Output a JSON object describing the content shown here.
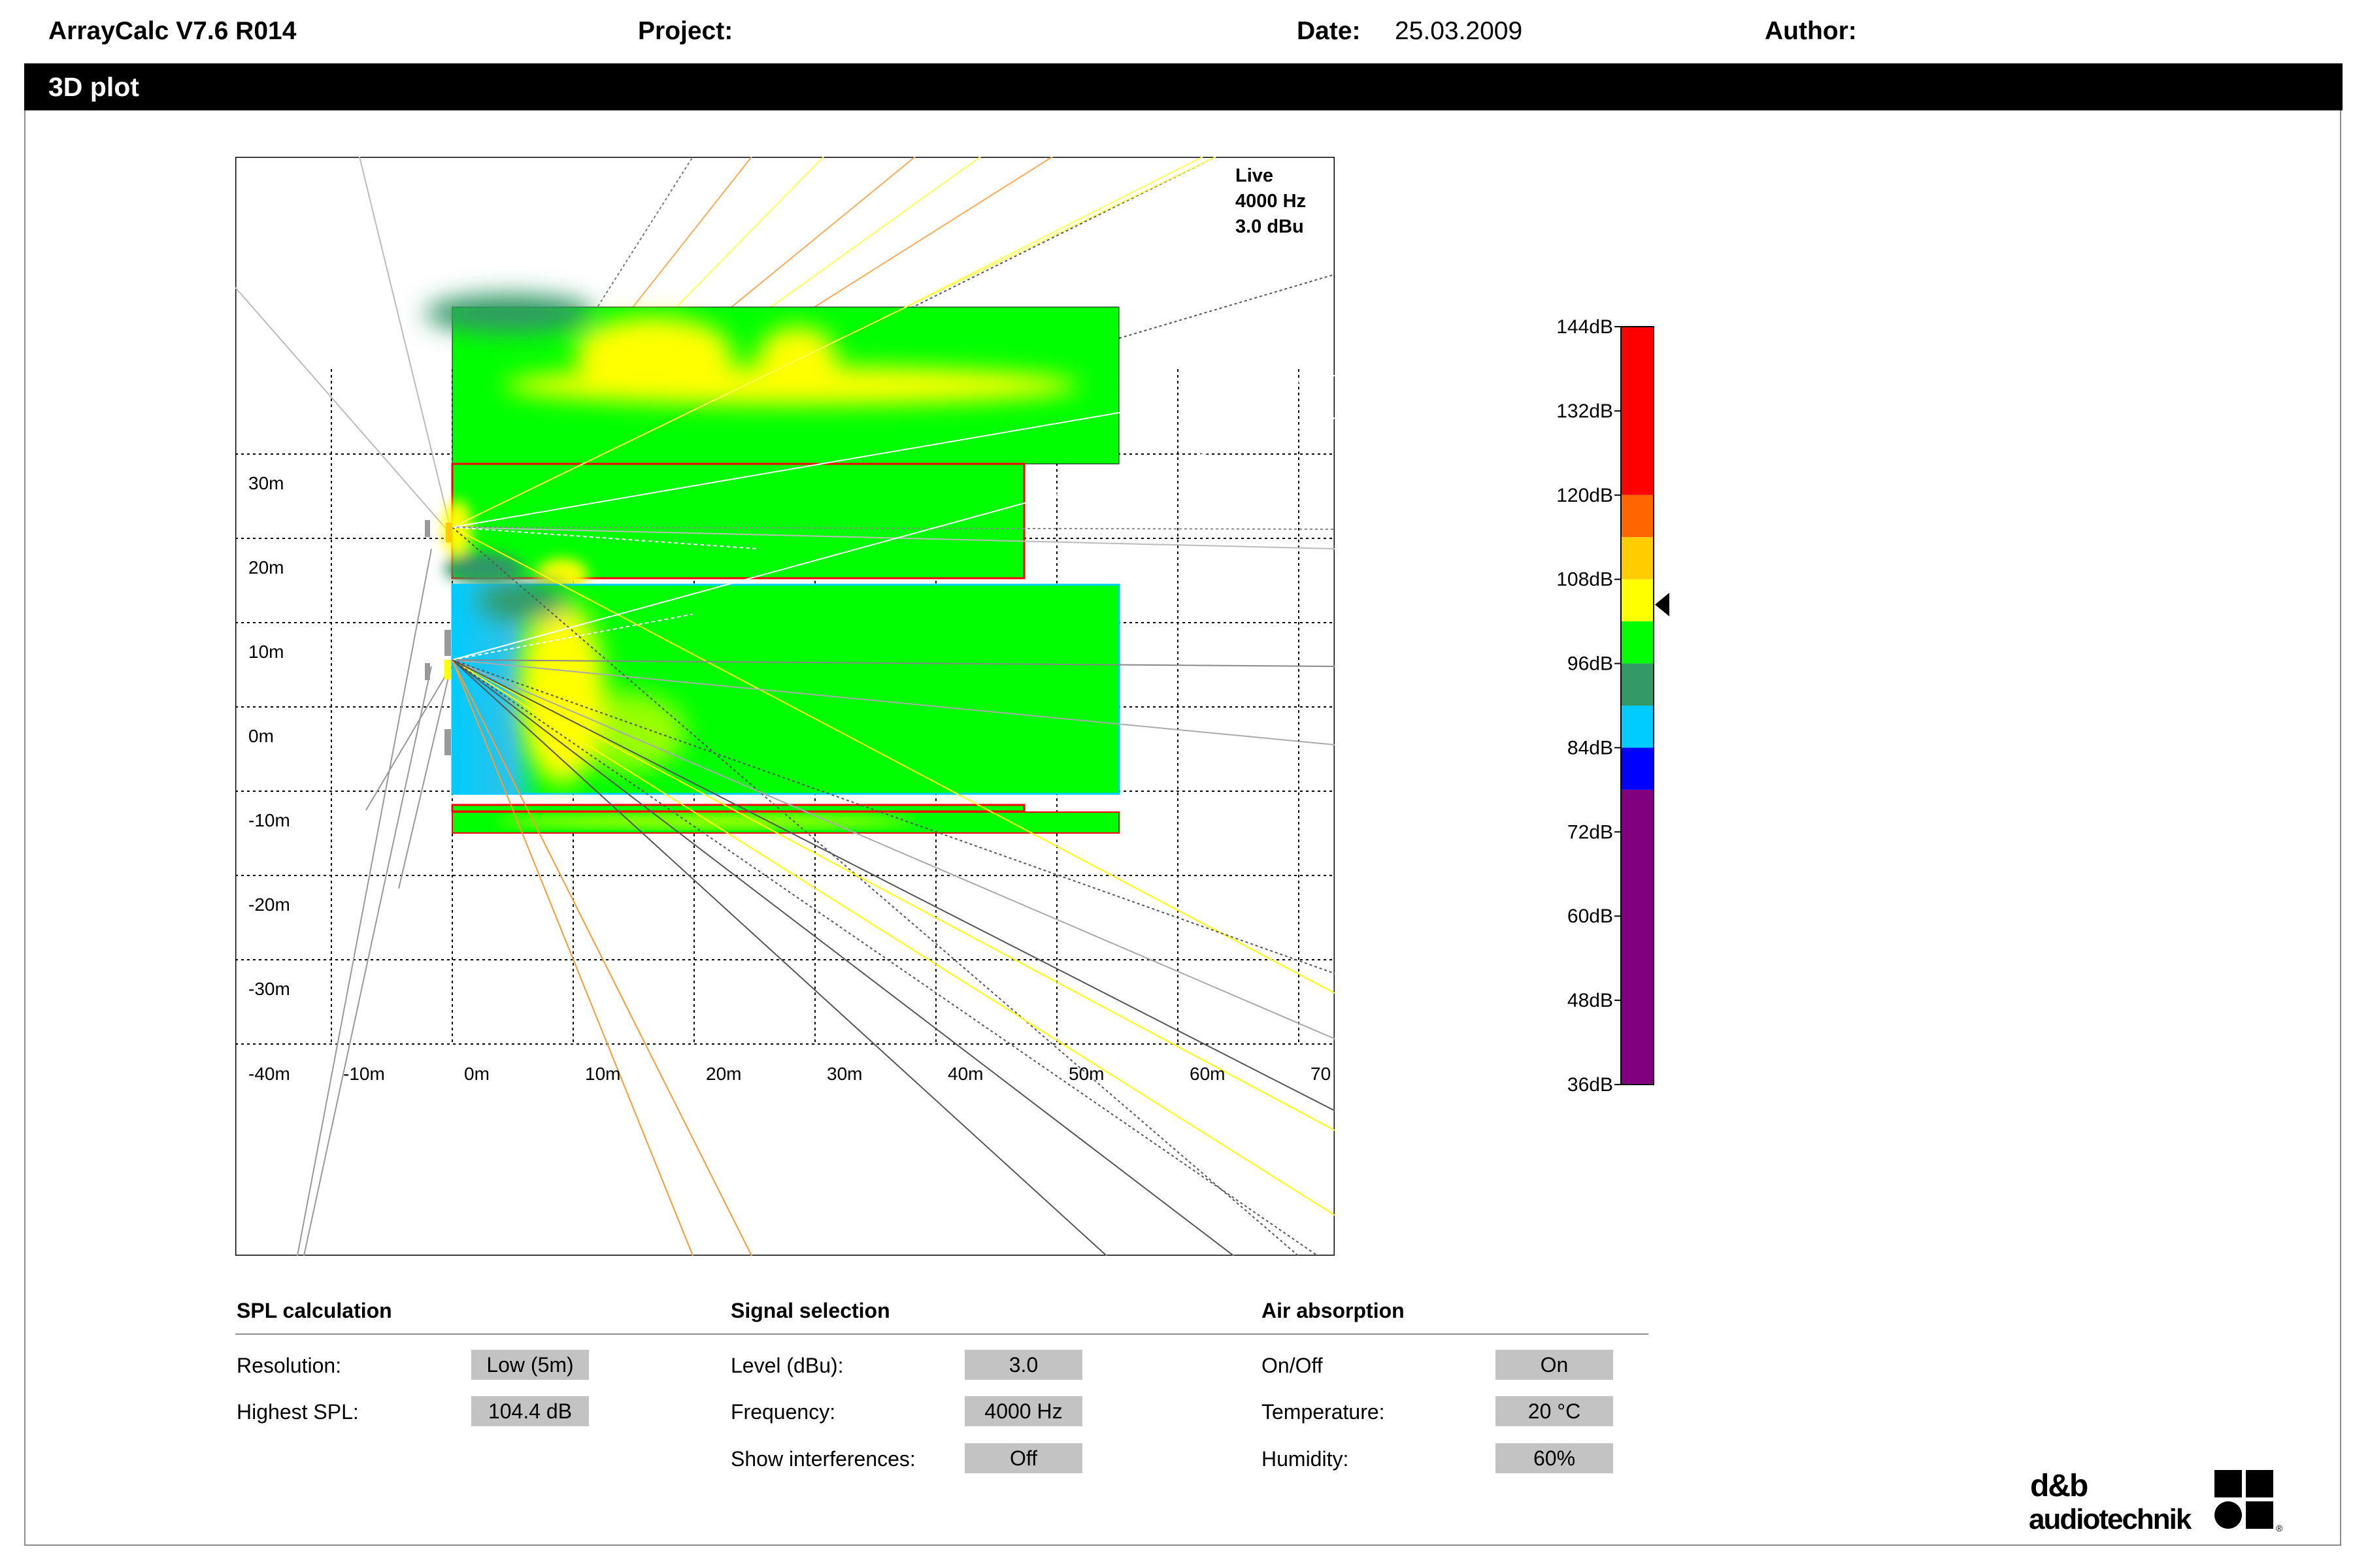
{
  "header": {
    "app": "ArrayCalc V7.6 R014",
    "project_label": "Project:",
    "date_label": "Date:",
    "date_value": "25.03.2009",
    "author_label": "Author:"
  },
  "panel_title": "3D plot",
  "plot": {
    "info_mode": "Live",
    "info_freq": "4000 Hz",
    "info_level": "3.0 dBu",
    "y_ticks": [
      "30m",
      "20m",
      "10m",
      "0m",
      "-10m",
      "-20m",
      "-30m"
    ],
    "x_ticks": [
      "-40m",
      "-10m",
      "0m",
      "10m",
      "20m",
      "30m",
      "40m",
      "50m",
      "60m",
      "70"
    ],
    "colors": {
      "green": "#00ff00",
      "yellow": "#ffff00",
      "cyan": "#00ccff",
      "red": "#ff0000",
      "orange": "#ff9933"
    }
  },
  "colorbar": {
    "labels": [
      "144dB",
      "132dB",
      "120dB",
      "108dB",
      "96dB",
      "84dB",
      "72dB",
      "60dB",
      "48dB",
      "36dB"
    ],
    "bands": [
      {
        "color": "#ff0000",
        "from_db": 120,
        "to_db": 144
      },
      {
        "color": "#ff6600",
        "from_db": 114,
        "to_db": 120
      },
      {
        "color": "#ffcc00",
        "from_db": 108,
        "to_db": 114
      },
      {
        "color": "#ffff00",
        "from_db": 102,
        "to_db": 108
      },
      {
        "color": "#00ff00",
        "from_db": 96,
        "to_db": 102
      },
      {
        "color": "#339966",
        "from_db": 90,
        "to_db": 96
      },
      {
        "color": "#00ccff",
        "from_db": 84,
        "to_db": 90
      },
      {
        "color": "#0000ff",
        "from_db": 78,
        "to_db": 84
      },
      {
        "color": "#800080",
        "from_db": 36,
        "to_db": 78
      }
    ],
    "marker_db": 104.4
  },
  "spl": {
    "title": "SPL calculation",
    "resolution_label": "Resolution:",
    "resolution_value": "Low (5m)",
    "highest_label": "Highest SPL:",
    "highest_value": "104.4 dB"
  },
  "signal": {
    "title": "Signal selection",
    "level_label": "Level (dBu):",
    "level_value": "3.0",
    "freq_label": "Frequency:",
    "freq_value": "4000 Hz",
    "interf_label": "Show interferences:",
    "interf_value": "Off"
  },
  "air": {
    "title": "Air absorption",
    "onoff_label": "On/Off",
    "onoff_value": "On",
    "temp_label": "Temperature:",
    "temp_value": "20 °C",
    "hum_label": "Humidity:",
    "hum_value": "60%"
  },
  "logo": {
    "line1": "d&b",
    "line2": "audiotechnik"
  }
}
